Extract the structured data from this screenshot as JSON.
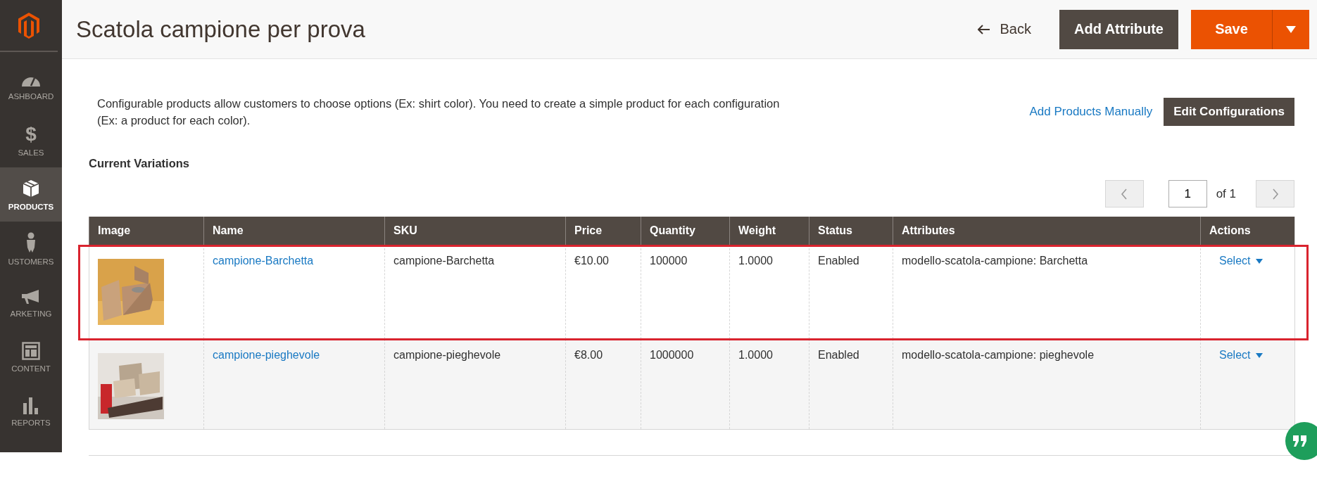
{
  "sidebar": {
    "items": [
      {
        "kind": "dashboard",
        "label": "ASHBOARD",
        "selected": false
      },
      {
        "kind": "sales",
        "icon": "$",
        "label": "SALES",
        "selected": false
      },
      {
        "kind": "products",
        "label": "PRODUCTS",
        "selected": true
      },
      {
        "kind": "customers",
        "label": "USTOMERS",
        "selected": false
      },
      {
        "kind": "marketing",
        "label": "ARKETING",
        "selected": false
      },
      {
        "kind": "content",
        "label": "CONTENT",
        "selected": false
      },
      {
        "kind": "reports",
        "label": "REPORTS",
        "selected": false
      }
    ]
  },
  "header": {
    "title": "Scatola campione per prova",
    "back": "Back",
    "add_attribute": "Add Attribute",
    "save": "Save"
  },
  "intro": {
    "text": "Configurable products allow customers to choose options (Ex: shirt color). You need to create a simple product for each configuration (Ex: a product for each color).",
    "add_manually": "Add Products Manually",
    "edit_configurations": "Edit Configurations"
  },
  "section_title": "Current Variations",
  "pager": {
    "page": "1",
    "of": "of 1"
  },
  "table": {
    "columns": [
      "Image",
      "Name",
      "SKU",
      "Price",
      "Quantity",
      "Weight",
      "Status",
      "Attributes",
      "Actions"
    ],
    "rows": [
      {
        "name": "campione-Barchetta",
        "sku": "campione-Barchetta",
        "price": "€10.00",
        "quantity": "100000",
        "weight": "1.0000",
        "status": "Enabled",
        "attributes": "modello-scatola-campione: Barchetta",
        "action": "Select",
        "highlighted": true
      },
      {
        "name": "campione-pieghevole",
        "sku": "campione-pieghevole",
        "price": "€8.00",
        "quantity": "1000000",
        "weight": "1.0000",
        "status": "Enabled",
        "attributes": "modello-scatola-campione: pieghevole",
        "action": "Select",
        "highlighted": false
      }
    ]
  }
}
